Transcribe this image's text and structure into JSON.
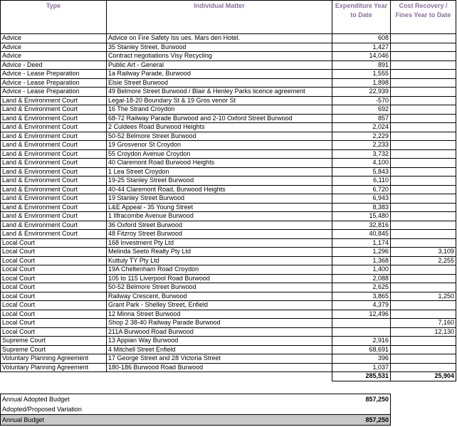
{
  "columns": {
    "type": "Type",
    "matter": "Individual Matter",
    "expenditure": "Expenditure Year to Date",
    "recovery": "Cost Recovery / Fines Year to Date"
  },
  "rows": [
    {
      "type": "Advice",
      "matter": "Advice on Fire Safety Iss ues. Mars den Hotel.",
      "exp": "608",
      "rec": ""
    },
    {
      "type": "Advice",
      "matter": "35 Stanley Street, Burwood",
      "exp": "1,427",
      "rec": ""
    },
    {
      "type": "Advice",
      "matter": "Contract negotiations Visy Recycling",
      "exp": "14,046",
      "rec": ""
    },
    {
      "type": "Advice - Deed",
      "matter": "Public Art - General",
      "exp": "891",
      "rec": ""
    },
    {
      "type": "Advice - Lease Preparation",
      "matter": "1a Railway Parade, Burwood",
      "exp": "1,555",
      "rec": ""
    },
    {
      "type": "Advice - Lease Preparation",
      "matter": "Elsie Street Burwood",
      "exp": "1,898",
      "rec": ""
    },
    {
      "type": "Advice - Lease Preparation",
      "matter": "49 Belmore Street Burwood / Blair & Henley Parks licence agreement",
      "exp": "22,939",
      "rec": ""
    },
    {
      "type": "Land & Environment Court",
      "matter": "Legal-18-20 Boundary St & 19 Gros venor St",
      "exp": "-570",
      "rec": ""
    },
    {
      "type": "Land & Environment Court",
      "matter": "16 The Strand Croydon",
      "exp": "692",
      "rec": ""
    },
    {
      "type": "Land & Environment Court",
      "matter": "68-72 Railway Parade Burwood and 2-10 Oxford Street Burwood",
      "exp": "857",
      "rec": ""
    },
    {
      "type": "Land & Environment Court",
      "matter": "2 Culdees Road Burwood Heights",
      "exp": "2,024",
      "rec": ""
    },
    {
      "type": "Land & Environment Court",
      "matter": "50-52 Belmore Street Burwood",
      "exp": "2,229",
      "rec": ""
    },
    {
      "type": "Land & Environment Court",
      "matter": "19 Grosvenor St Croydon",
      "exp": "2,233",
      "rec": ""
    },
    {
      "type": "Land & Environment Court",
      "matter": "55 Croydon Avenue Croydon",
      "exp": "3,732",
      "rec": ""
    },
    {
      "type": "Land & Environment Court",
      "matter": "40 Claremont Road Burwood Heights",
      "exp": "4,100",
      "rec": ""
    },
    {
      "type": "Land & Environment Court",
      "matter": "1 Lea Street Croydon",
      "exp": "5,843",
      "rec": ""
    },
    {
      "type": "Land & Environment Court",
      "matter": "19-25 Stanley Street Burwood",
      "exp": "6,110",
      "rec": ""
    },
    {
      "type": "Land & Environment Court",
      "matter": "40-44 Claremont Road, Burwood Heights",
      "exp": "6,720",
      "rec": ""
    },
    {
      "type": "Land & Environment Court",
      "matter": "19 Stanley Street Burwood",
      "exp": "6,943",
      "rec": ""
    },
    {
      "type": "Land & Environment Court",
      "matter": "L&E Appeal - 35 Young Street",
      "exp": "8,383",
      "rec": ""
    },
    {
      "type": "Land & Environment Court",
      "matter": "1 Ilfracombe Avenue Burwood",
      "exp": "15,480",
      "rec": ""
    },
    {
      "type": "Land & Environment Court",
      "matter": "36 Oxford Street Burwood",
      "exp": "32,816",
      "rec": ""
    },
    {
      "type": "Land & Environment Court",
      "matter": "48 Fitzroy Street Burwood",
      "exp": "40,845",
      "rec": ""
    },
    {
      "type": "Local Court",
      "matter": "168 Investment Pty Ltd",
      "exp": "1,174",
      "rec": ""
    },
    {
      "type": "Local Court",
      "matter": "Melinda Seeto Realty Pty Ltd",
      "exp": "1,296",
      "rec": "3,109"
    },
    {
      "type": "Local Court",
      "matter": "Kuttuly TY Pty Ltd",
      "exp": "1,368",
      "rec": "2,255"
    },
    {
      "type": "Local Court",
      "matter": "19A Cheltenham Road Croydon",
      "exp": "1,400",
      "rec": ""
    },
    {
      "type": "Local Court",
      "matter": "105 to 115 Liverpool Road Burwood",
      "exp": "2,088",
      "rec": ""
    },
    {
      "type": "Local Court",
      "matter": "50-52 Belmore Street Burwood",
      "exp": "2,625",
      "rec": ""
    },
    {
      "type": "Local Court",
      "matter": "Railway Crescent, Burwood",
      "exp": "3,865",
      "rec": "1,250"
    },
    {
      "type": "Local Court",
      "matter": "Grant Park - Shelley Street, Enfield",
      "exp": "4,379",
      "rec": ""
    },
    {
      "type": "Local Court",
      "matter": "12 Minna Street Burwood",
      "exp": "12,496",
      "rec": ""
    },
    {
      "type": "Local Court",
      "matter": "Shop 2 38-40 Railway Parade Burwood",
      "exp": "",
      "rec": "7,160"
    },
    {
      "type": "Local Court",
      "matter": "211A Burwood Road Burwood",
      "exp": "",
      "rec": "12,130"
    },
    {
      "type": "Supreme Court",
      "matter": "13 Appian Way Burwood",
      "exp": "2,916",
      "rec": ""
    },
    {
      "type": "Supreme Court",
      "matter": "4 Mitchell Street Enfield",
      "exp": "68,691",
      "rec": ""
    },
    {
      "type": "Voluntary Planning Agreement",
      "matter": "17 George Street and 28 Victoria Street",
      "exp": "396",
      "rec": ""
    },
    {
      "type": "Voluntary Planning Agreement",
      "matter": "180-186 Burwood Road Burwood",
      "exp": "1,037",
      "rec": ""
    }
  ],
  "totals": {
    "exp": "285,531",
    "rec": "25,904"
  },
  "budget": {
    "adopted_label": "Annual Adopted Budget",
    "adopted_value": "857,250",
    "variation_label": "Adopted/Proposed Variation",
    "variation_value": "",
    "annual_label": "Annual Budget",
    "annual_value": "857,250"
  }
}
